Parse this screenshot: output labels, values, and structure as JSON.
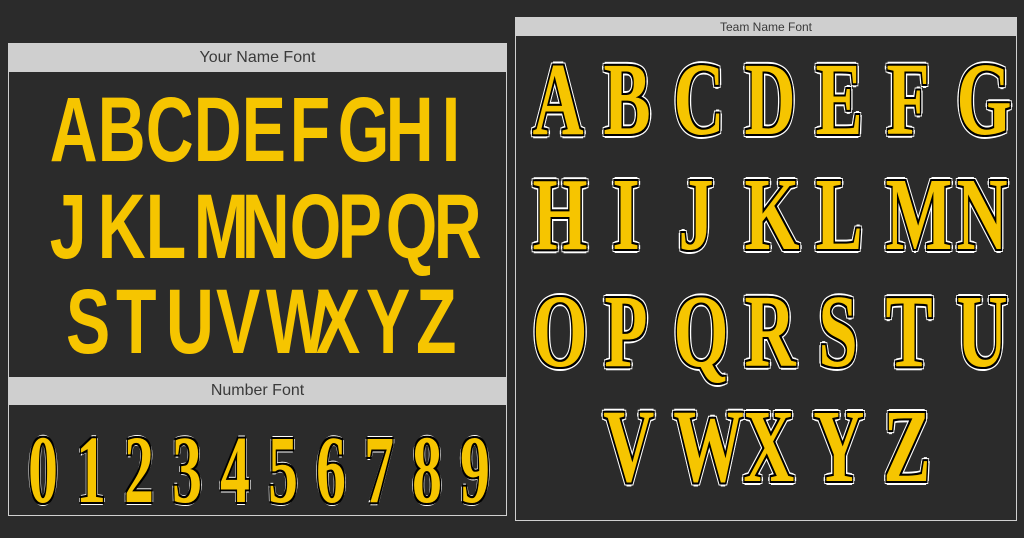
{
  "left": {
    "name_header": "Your Name Font",
    "number_header": "Number Font",
    "name_rows": [
      [
        "A",
        "B",
        "C",
        "D",
        "E",
        "F",
        "G",
        "H",
        "I"
      ],
      [
        "J",
        "K",
        "L",
        "M",
        "N",
        "O",
        "P",
        "Q",
        "R"
      ],
      [
        "S",
        "T",
        "U",
        "V",
        "W",
        "X",
        "Y",
        "Z"
      ]
    ],
    "numbers": [
      "0",
      "1",
      "2",
      "3",
      "4",
      "5",
      "6",
      "7",
      "8",
      "9"
    ]
  },
  "right": {
    "team_header": "Team Name Font",
    "team_rows": [
      [
        "A",
        "B",
        "C",
        "D",
        "E",
        "F",
        "G"
      ],
      [
        "H",
        "I",
        "J",
        "K",
        "L",
        "M",
        "N"
      ],
      [
        "O",
        "P",
        "Q",
        "R",
        "S",
        "T",
        "U"
      ],
      [
        "V",
        "W",
        "X",
        "Y",
        "Z"
      ]
    ]
  },
  "colors": {
    "background": "#2b2b2b",
    "header": "#cfcfcf",
    "letter": "#f6c500"
  }
}
